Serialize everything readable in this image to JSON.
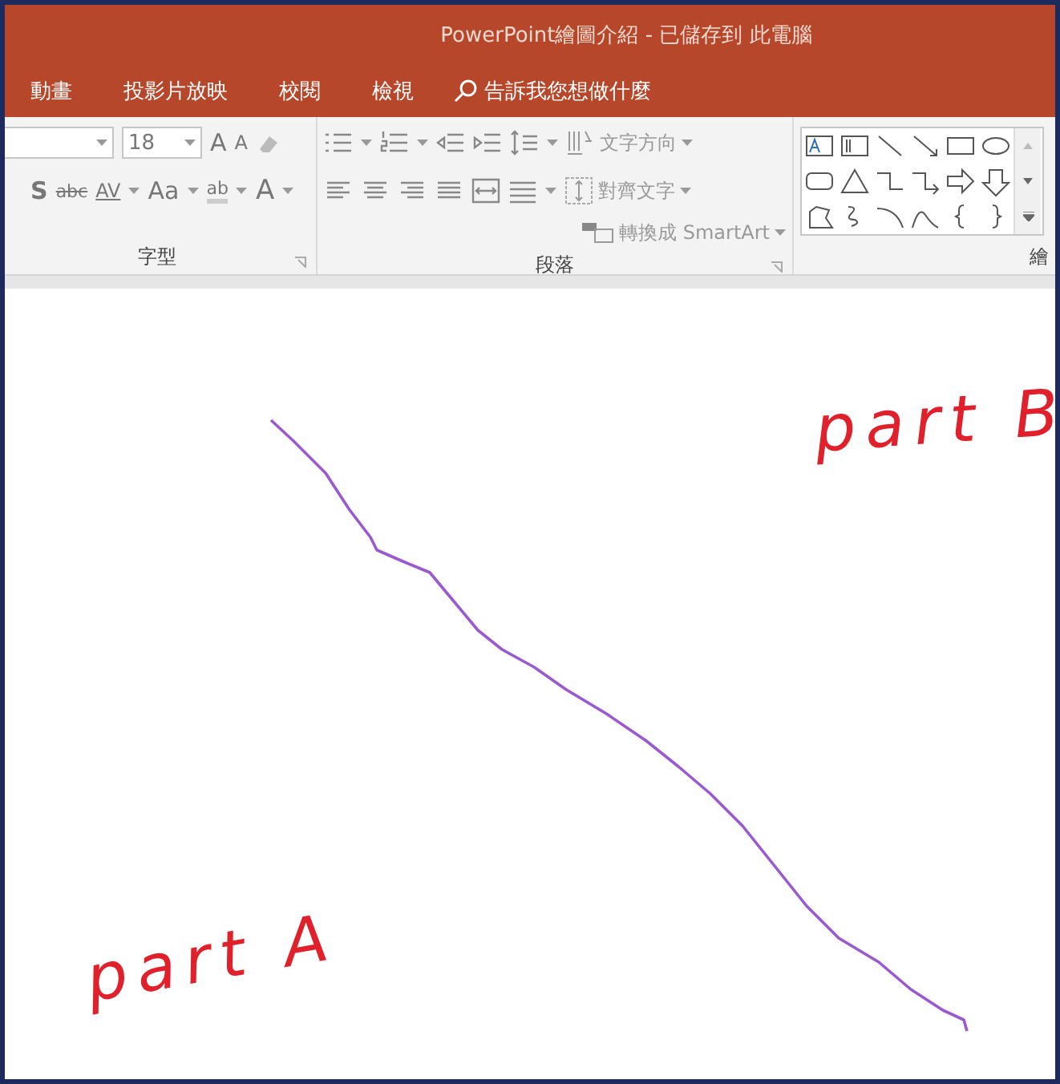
{
  "window": {
    "title": "PowerPoint繪圖介紹  -  已儲存到 此電腦"
  },
  "tabs": [
    {
      "label": "動畫"
    },
    {
      "label": "投影片放映"
    },
    {
      "label": "校閱"
    },
    {
      "label": "檢視"
    }
  ],
  "search": {
    "placeholder": "告訴我您想做什麼"
  },
  "font_group": {
    "label": "字型",
    "font_size": "18",
    "grow": "A",
    "shrink": "A",
    "shadow": "S",
    "strike": "abc",
    "spacing": "AV",
    "case": "Aa",
    "highlight": "ab",
    "font_color": "A"
  },
  "paragraph_group": {
    "label": "段落",
    "commands": [
      "文字方向",
      "對齊文字",
      "轉換成 SmartArt"
    ]
  },
  "drawing_group": {
    "label": "繪"
  },
  "slide": {
    "ink_labels": [
      "part B",
      "part A"
    ]
  }
}
